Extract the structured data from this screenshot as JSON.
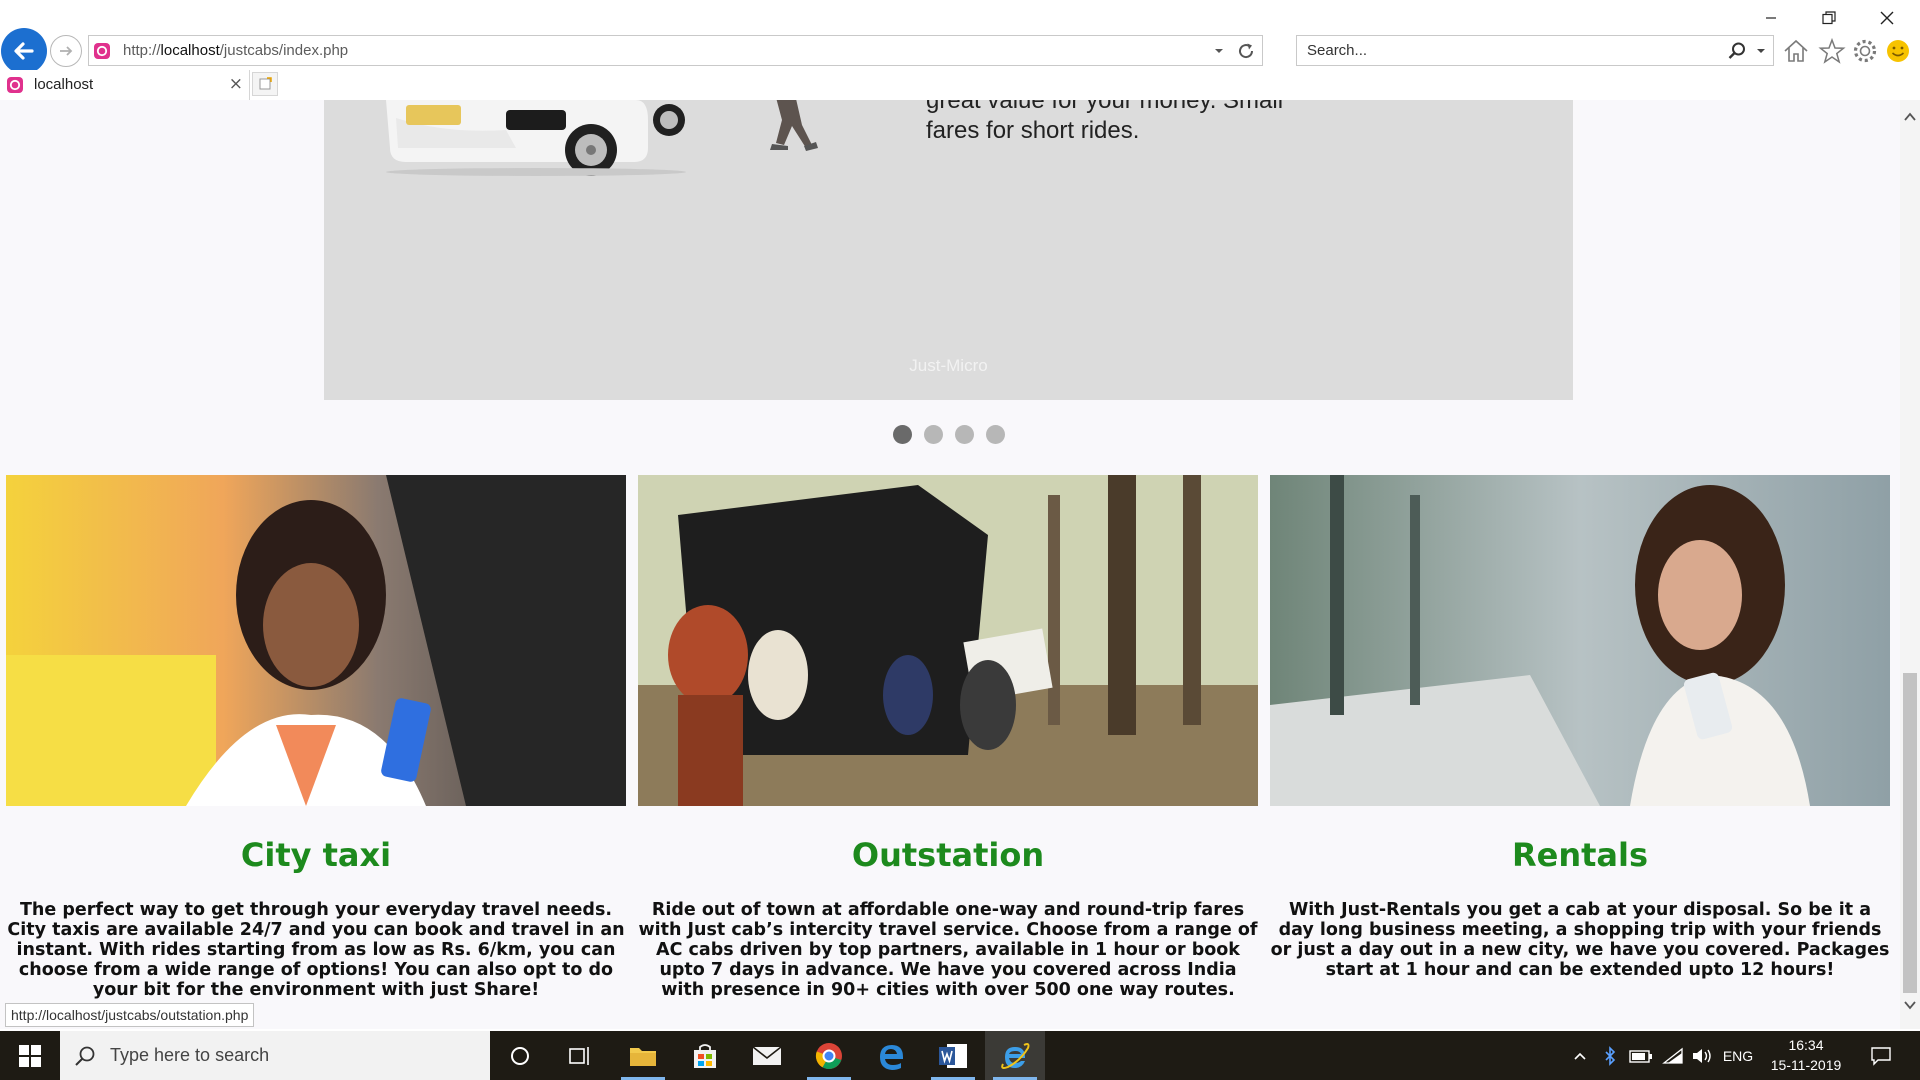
{
  "browser": {
    "url_prefix": "http://",
    "url_host": "localhost",
    "url_path": "/justcabs/index.php",
    "search_placeholder": "Search...",
    "tab_title": "localhost",
    "tab_close": "×",
    "status_url": "http://localhost/justcabs/outstation.php"
  },
  "carousel": {
    "text_line1": "great value for your money. Small",
    "text_line2": "fares for short rides.",
    "caption": "Just-Micro",
    "dots": 4,
    "active_dot": 1
  },
  "cards": [
    {
      "title": "City taxi",
      "body": "The perfect way to get through your everyday travel needs. City taxis are available 24/7 and you can book and travel in an instant. With rides starting from as low as Rs. 6/km, you can choose from a wide range of options! You can also opt to do your bit for the environment with just Share!"
    },
    {
      "title": "Outstation",
      "body": "Ride out of town at affordable one-way and round-trip fares with Just cab’s intercity travel service. Choose from a range of AC cabs driven by top partners, available in 1 hour or book upto 7 days in advance. We have you covered across India with presence in 90+ cities with over 500 one way routes."
    },
    {
      "title": "Rentals",
      "body": "With Just-Rentals you get a cab at your disposal. So be it a day long business meeting, a shopping trip with your friends or just a day out in a new city, we have you covered. Packages start at 1 hour and can be extended upto 12 hours!"
    }
  ],
  "taskbar": {
    "search_placeholder": "Type here to search",
    "lang": "ENG",
    "time": "16:34",
    "date": "15-11-2019"
  },
  "colors": {
    "card_title": "#1d8a1d",
    "back_button": "#1c6fd0",
    "carousel_bg": "#dcdcdc",
    "taskbar_bg": "#1e1b14"
  }
}
